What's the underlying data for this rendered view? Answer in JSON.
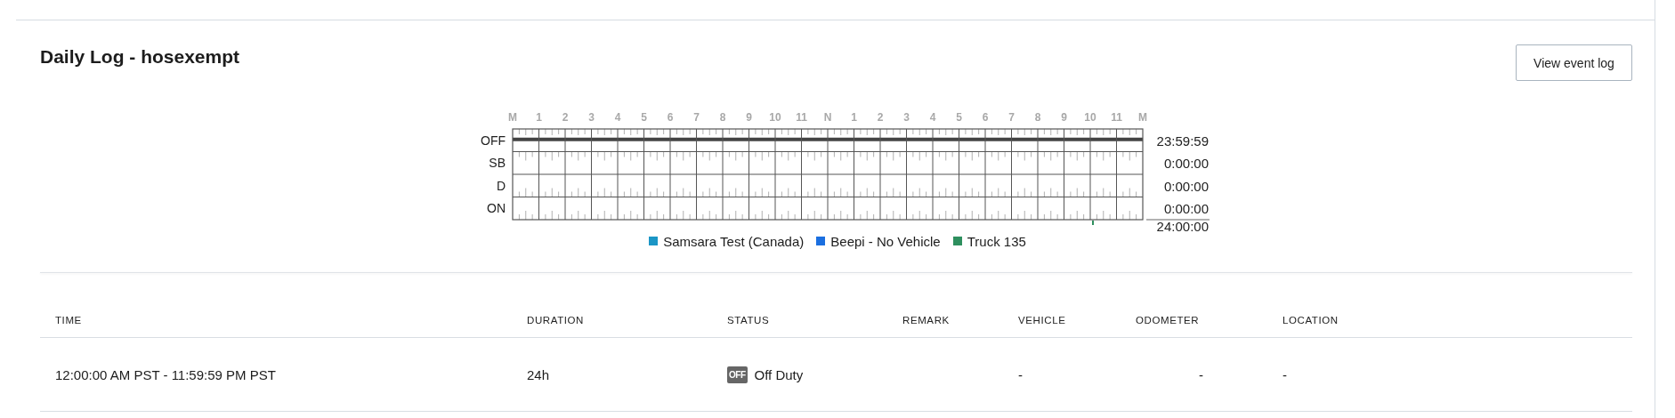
{
  "title": "Daily Log - hosexempt",
  "view_event_log_button": "View event log",
  "log_graph": {
    "hours": [
      "M",
      "1",
      "2",
      "3",
      "4",
      "5",
      "6",
      "7",
      "8",
      "9",
      "10",
      "11",
      "N",
      "1",
      "2",
      "3",
      "4",
      "5",
      "6",
      "7",
      "8",
      "9",
      "10",
      "11",
      "M"
    ],
    "rows": [
      {
        "label": "OFF",
        "total": "23:59:59",
        "active": true
      },
      {
        "label": "SB",
        "total": "0:00:00",
        "active": false
      },
      {
        "label": "D",
        "total": "0:00:00",
        "active": false
      },
      {
        "label": "ON",
        "total": "0:00:00",
        "active": false
      }
    ],
    "grand_total": "24:00:00",
    "legend": [
      {
        "label": "Samsara Test (Canada)",
        "color": "#1b96c6"
      },
      {
        "label": "Beepi - No Vehicle",
        "color": "#1b6fe0"
      },
      {
        "label": "Truck 135",
        "color": "#2e8f5e"
      }
    ]
  },
  "table": {
    "columns": [
      "TIME",
      "DURATION",
      "STATUS",
      "REMARK",
      "VEHICLE",
      "ODOMETER",
      "LOCATION"
    ],
    "rows": [
      {
        "time": "12:00:00 AM PST - 11:59:59 PM PST",
        "duration": "24h",
        "status_badge": "OFF",
        "status": "Off Duty",
        "vehicle": "-",
        "odometer": "-",
        "location": "-"
      }
    ]
  }
}
